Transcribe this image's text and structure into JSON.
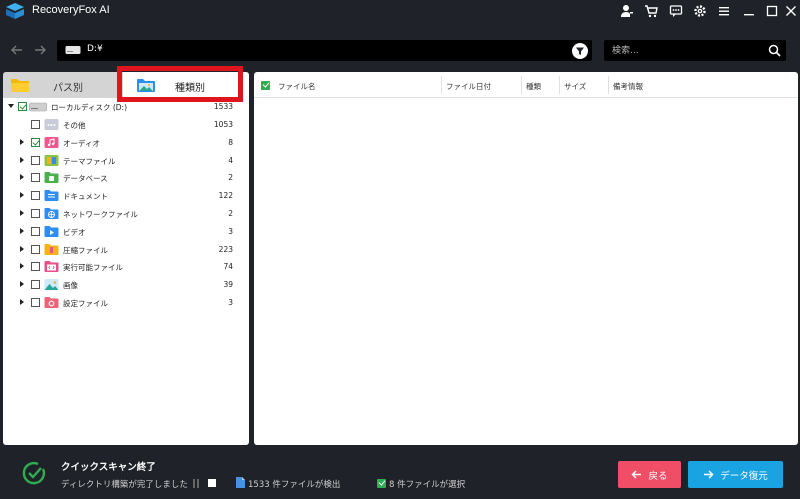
{
  "app": {
    "title": "RecoveryFox AI",
    "accent_color": "#1aa3e3",
    "highlight_color": "#e0141c"
  },
  "titlebar_icons": [
    "user-key-icon",
    "cart-icon",
    "feedback-icon",
    "settings-icon",
    "menu-icon",
    "minimize-icon",
    "maximize-icon",
    "close-icon"
  ],
  "address": {
    "path": "D:¥",
    "search_placeholder": "検索..."
  },
  "left_panel": {
    "tabs": [
      {
        "label": "パス別",
        "icon": "folder-icon",
        "active": false
      },
      {
        "label": "種類別",
        "icon": "image-folder-icon",
        "active": true
      }
    ],
    "root": {
      "label": "ローカルディスク (D:)",
      "count": "1533",
      "checked": true,
      "expanded": true
    },
    "items": [
      {
        "label": "その他",
        "count": "1053",
        "checked": false,
        "has_children": false,
        "icon": "other-files-icon",
        "color": "#c9cbd8"
      },
      {
        "label": "オーディオ",
        "count": "8",
        "checked": true,
        "has_children": true,
        "icon": "audio-file-icon",
        "color": "#f0578a"
      },
      {
        "label": "テーマファイル",
        "count": "4",
        "checked": false,
        "has_children": true,
        "icon": "theme-file-icon",
        "color": "#8bc34a"
      },
      {
        "label": "データベース",
        "count": "2",
        "checked": false,
        "has_children": true,
        "icon": "database-file-icon",
        "color": "#4caf50"
      },
      {
        "label": "ドキュメント",
        "count": "122",
        "checked": false,
        "has_children": true,
        "icon": "document-file-icon",
        "color": "#2f8cf0"
      },
      {
        "label": "ネットワークファイル",
        "count": "2",
        "checked": false,
        "has_children": true,
        "icon": "network-file-icon",
        "color": "#2f8cf0"
      },
      {
        "label": "ビデオ",
        "count": "3",
        "checked": false,
        "has_children": true,
        "icon": "video-file-icon",
        "color": "#2f8cf0"
      },
      {
        "label": "圧縮ファイル",
        "count": "223",
        "checked": false,
        "has_children": true,
        "icon": "archive-file-icon",
        "color": "#f7b21b"
      },
      {
        "label": "実行可能ファイル",
        "count": "74",
        "checked": false,
        "has_children": true,
        "icon": "executable-file-icon",
        "color": "#e94f8a"
      },
      {
        "label": "画像",
        "count": "39",
        "checked": false,
        "has_children": true,
        "icon": "image-file-icon",
        "color": "#26a69a"
      },
      {
        "label": "設定ファイル",
        "count": "3",
        "checked": false,
        "has_children": true,
        "icon": "config-file-icon",
        "color": "#f06277"
      }
    ]
  },
  "file_table": {
    "columns": [
      "ファイル名",
      "ファイル日付",
      "種類",
      "サイズ",
      "備考情報"
    ],
    "rows": []
  },
  "status": {
    "title": "クイックスキャン終了",
    "subtitle": "ディレクトリ構築が完了しました",
    "found": "1533 件ファイルが検出",
    "selected": "8 件ファイルが選択",
    "back_label": "戻る",
    "restore_label": "データ復元"
  }
}
